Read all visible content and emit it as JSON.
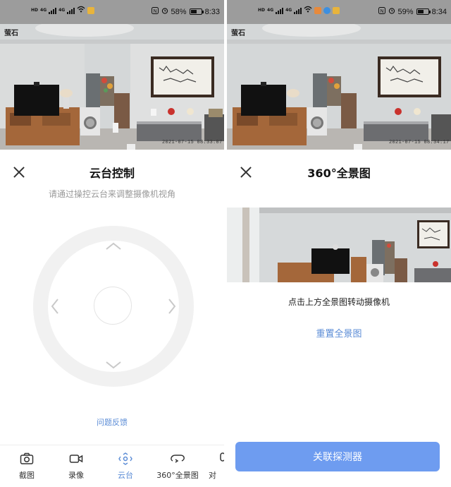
{
  "left_panel": {
    "status_bar": {
      "signal_tag": "HD",
      "network": "4G",
      "battery": "58%",
      "battery_level": 0.58,
      "time": "8:33"
    },
    "camera_feed": {
      "brand": "萤石",
      "timestamp": "2021-07-15 08:33:07"
    },
    "header": {
      "title": "云台控制",
      "subtitle": "请通过操控云台来调整摄像机视角"
    },
    "feedback_link": "问题反馈",
    "tabs": [
      {
        "label": "截图",
        "icon": "camera-icon"
      },
      {
        "label": "录像",
        "icon": "video-icon"
      },
      {
        "label": "云台",
        "icon": "ptz-icon",
        "active": true
      },
      {
        "label": "360°全景图",
        "icon": "panorama-icon"
      },
      {
        "label": "对",
        "icon": "mic-icon"
      }
    ],
    "colors": {
      "accent": "#5b8cd6",
      "joystick_ring": "#f1f1f1"
    }
  },
  "right_panel": {
    "status_bar": {
      "signal_tag": "HD",
      "network": "4G",
      "battery": "59%",
      "battery_level": 0.59,
      "time": "8:34"
    },
    "camera_feed": {
      "brand": "萤石",
      "timestamp": "2021-07-15 08:34:17"
    },
    "header": {
      "title": "360°全景图"
    },
    "instruction": "点击上方全景图转动摄像机",
    "reset_link": "重置全景图",
    "primary_button": "关联探测器",
    "colors": {
      "button": "#6e9cf0",
      "link": "#5b8cd6"
    }
  }
}
